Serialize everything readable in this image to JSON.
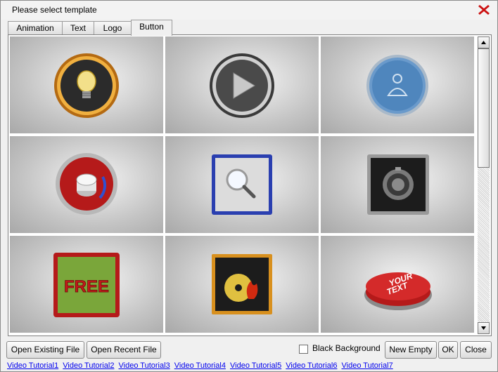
{
  "window": {
    "title": "Please select template"
  },
  "tabs": [
    {
      "label": "Animation",
      "active": false
    },
    {
      "label": "Text",
      "active": false
    },
    {
      "label": "Logo",
      "active": false
    },
    {
      "label": "Button",
      "active": true
    }
  ],
  "templates": {
    "free_label": "FREE",
    "your_text_label_1": "YOUR",
    "your_text_label_2": "TEXT",
    "items": [
      {
        "icon": "lightbulb-button-icon"
      },
      {
        "icon": "play-button-icon"
      },
      {
        "icon": "user-button-icon"
      },
      {
        "icon": "knob-button-icon"
      },
      {
        "icon": "magnifier-button-icon"
      },
      {
        "icon": "speaker-button-icon"
      },
      {
        "icon": "free-button-icon"
      },
      {
        "icon": "disc-flame-button-icon"
      },
      {
        "icon": "your-text-button-icon"
      }
    ]
  },
  "footer": {
    "open_existing": "Open Existing File",
    "open_recent": "Open Recent File",
    "black_background": "Black Background",
    "black_background_checked": false,
    "new_empty": "New Empty",
    "ok": "OK",
    "close": "Close"
  },
  "tutorials": [
    "Video Tutorial1",
    "Video Tutorial2",
    "Video Tutorial3",
    "Video Tutorial4",
    "Video Tutorial5",
    "Video Tutorial6",
    "Video Tutorial7"
  ],
  "colors": {
    "close_icon": "#cc1111",
    "link": "#0000ee"
  }
}
